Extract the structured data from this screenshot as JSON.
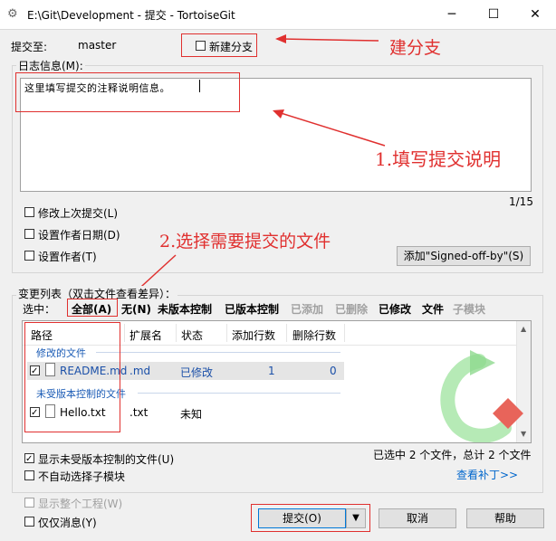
{
  "window": {
    "title": "E:\\Git\\Development - 提交 - TortoiseGit",
    "controls": [
      "─",
      "☐",
      "✕"
    ]
  },
  "commit_to": {
    "label": "提交至:",
    "branch": "master",
    "new_branch_label": "新建分支"
  },
  "message": {
    "label": "日志信息(M):",
    "text": "这里填写提交的注释说明信息。",
    "counter": "1/15"
  },
  "options": {
    "amend": "修改上次提交(L)",
    "set_date": "设置作者日期(D)",
    "set_author": "设置作者(T)",
    "signed_off": "添加\"Signed-off-by\"(S)"
  },
  "changes": {
    "label": "变更列表（双击文件查看差异）：",
    "select_label": "选中：",
    "filters": [
      {
        "label": "全部(A)",
        "enabled": true
      },
      {
        "label": "无(N)",
        "enabled": true
      },
      {
        "label": "未版本控制",
        "enabled": true
      },
      {
        "label": "已版本控制",
        "enabled": true
      },
      {
        "label": "已添加",
        "enabled": false
      },
      {
        "label": "已删除",
        "enabled": false
      },
      {
        "label": "已修改",
        "enabled": true
      },
      {
        "label": "文件",
        "enabled": true
      },
      {
        "label": "子模块",
        "enabled": false
      }
    ],
    "columns": [
      "路径",
      "扩展名",
      "状态",
      "添加行数",
      "删除行数"
    ],
    "groups": [
      {
        "label": "修改的文件",
        "rows": [
          {
            "path": "README.md",
            "ext": ".md",
            "status": "已修改",
            "added": "1",
            "removed": "0",
            "checked": true
          }
        ]
      },
      {
        "label": "未受版本控制的文件",
        "rows": [
          {
            "path": "Hello.txt",
            "ext": ".txt",
            "status": "未知",
            "added": "",
            "removed": "",
            "checked": true
          }
        ]
      }
    ],
    "show_unversioned": "显示未受版本控制的文件(U)",
    "no_auto_submodule": "不自动选择子模块",
    "summary": "已选中 2 个文件，总计 2 个文件",
    "view_patch": "查看补丁>>"
  },
  "bottom": {
    "show_whole_project": "显示整个工程(W)",
    "message_only": "仅仅消息(Y)",
    "commit_button": "提交(O)",
    "cancel_button": "取消",
    "help_button": "帮助"
  },
  "annotations": {
    "new_branch": "建分支",
    "fill_message": "1.填写提交说明",
    "select_files": "2.选择需要提交的文件"
  },
  "colors": {
    "annotation_red": "#e0302f",
    "group_blue": "#1a5bb5",
    "link_blue": "#0066cc"
  }
}
